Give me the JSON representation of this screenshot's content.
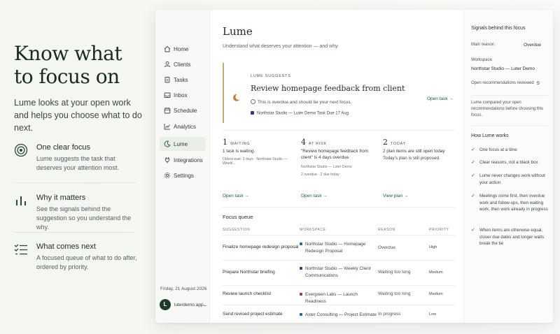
{
  "hero": {
    "headline": "Know what to focus on",
    "lead": "Lume looks at your open work and helps you choose what to do next."
  },
  "features": [
    {
      "icon": "target-icon",
      "title": "One clear focus",
      "text": "Lume suggests the task that deserves your attention most."
    },
    {
      "icon": "bar-chart-icon",
      "title": "Why it matters",
      "text": "See the signals behind the suggestion so you understand the why."
    },
    {
      "icon": "checklist-icon",
      "title": "What comes next",
      "text": "A focused queue of what to do after, ordered by priority."
    }
  ],
  "sidebar": {
    "items": [
      {
        "label": "Home",
        "icon": "home-icon"
      },
      {
        "label": "Clients",
        "icon": "user-icon"
      },
      {
        "label": "Tasks",
        "icon": "clipboard-icon"
      },
      {
        "label": "Inbox",
        "icon": "inbox-icon"
      },
      {
        "label": "Schedule",
        "icon": "calendar-icon"
      },
      {
        "label": "Analytics",
        "icon": "analytics-icon"
      },
      {
        "label": "Lume",
        "icon": "moon-icon",
        "active": true
      },
      {
        "label": "Integrations",
        "icon": "plug-icon"
      },
      {
        "label": "Settings",
        "icon": "gear-icon"
      }
    ],
    "date": "Friday, 21 August 2026",
    "user": {
      "initial": "L",
      "name": "luterdemo.app..."
    }
  },
  "main": {
    "title": "Lume",
    "subtitle": "Understand what deserves your attention — and why.",
    "suggestion": {
      "tag": "LUME SUGGESTS",
      "title": "Review homepage feedback from client",
      "note": "This is overdue and should be your next focus.",
      "meta": "Northstar Studio — Luter Demo     Task     Due 17 Aug",
      "action": "Open task →",
      "accent": "#c9a66b"
    },
    "stats": [
      {
        "num": "1",
        "label": "WAITING",
        "desc": "1 task is waiting.",
        "sub": "Oldest wait: 3 days · Northstar Studio — Weekl...",
        "action": "Open task →"
      },
      {
        "num": "4",
        "label": "AT RISK",
        "desc": "\"Review homepage feedback from client\" is 4 days overdue.",
        "sub": "Northstar Studio — Luter Demo",
        "sub2": "2 overdue · 2 due today",
        "action": "Open task →"
      },
      {
        "num": "2",
        "label": "TODAY",
        "desc": "2 plan items are still open today",
        "sub": "Today's plan is still proposed.",
        "action": "View plan →"
      }
    ],
    "queue": {
      "title": "Focus queue",
      "headers": [
        "SUGGESTION",
        "WORKSPACE",
        "REASON",
        "PRIORITY"
      ],
      "rows": [
        {
          "suggestion": "Finalize homepage redesign proposal",
          "workspace": "Northstar Studio — Homepage Redesign Proposal",
          "color": "#2a6a7a",
          "reason": "Overdue",
          "priority": "High"
        },
        {
          "suggestion": "Prepare Northstar briefing",
          "workspace": "Northstar Studio — Weekly Client Communications",
          "color": "#5b2c7a",
          "reason": "Waiting too long",
          "priority": "Medium"
        },
        {
          "suggestion": "Review launch checklist",
          "workspace": "Evergreen Labs — Launch Readiness",
          "color": "#a33a3a",
          "reason": "Waiting too long",
          "priority": "Medium"
        },
        {
          "suggestion": "Send revised project estimate",
          "workspace": "Aster Consulting — Project Estimate",
          "color": "#2a6a7a",
          "reason": "In progress",
          "priority": "Low"
        }
      ]
    }
  },
  "signals": {
    "title": "Signals behind this focus",
    "main_reason_label": "Main reason",
    "main_reason_value": "Overdue",
    "workspace_label": "Workspace",
    "workspace_value": "Northstar Studio — Luter Demo",
    "open_recs_label": "Open recommendations reviewed",
    "open_recs_value": "5",
    "compare_text": "Lume compared your open recommendations before choosing this focus.",
    "how_title": "How Lume works",
    "how_items": [
      "One focus at a time",
      "Clear reasons, not a black box",
      "Lume never changes work without your action",
      "Meetings come first, then overdue work and follow-ups, then waiting work, then work already in progress",
      "When items are otherwise equal, closer due dates and longer waits break the tie"
    ]
  }
}
